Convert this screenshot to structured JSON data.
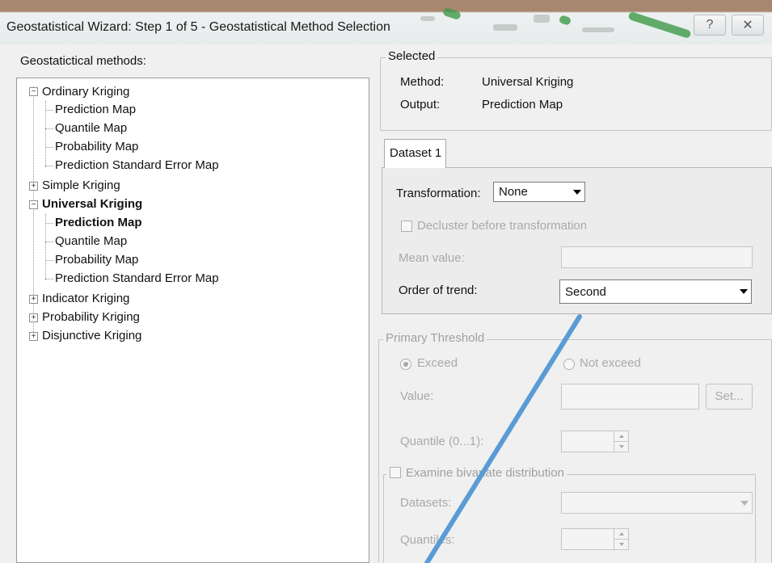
{
  "window": {
    "title": "Geostatistical Wizard: Step 1 of 5 - Geostatistical Method Selection",
    "help_icon": "help-icon",
    "close_icon": "close-icon",
    "help_glyph": "?",
    "close_glyph": "✕"
  },
  "tree": {
    "label": "Geostatictical methods:",
    "collapse_glyph": "−",
    "expand_glyph": "+",
    "nodes": [
      {
        "label": "Ordinary Kriging",
        "level": 0,
        "expander": "minus",
        "bold": false
      },
      {
        "label": "Prediction Map",
        "level": 1,
        "bold": false
      },
      {
        "label": "Quantile Map",
        "level": 1,
        "bold": false
      },
      {
        "label": "Probability Map",
        "level": 1,
        "bold": false
      },
      {
        "label": "Prediction Standard Error Map",
        "level": 1,
        "bold": false
      },
      {
        "label": "Simple Kriging",
        "level": 0,
        "expander": "plus",
        "bold": false
      },
      {
        "label": "Universal Kriging",
        "level": 0,
        "expander": "minus",
        "bold": true
      },
      {
        "label": "Prediction Map",
        "level": 1,
        "bold": true
      },
      {
        "label": "Quantile Map",
        "level": 1,
        "bold": false
      },
      {
        "label": "Probability Map",
        "level": 1,
        "bold": false
      },
      {
        "label": "Prediction Standard Error Map",
        "level": 1,
        "bold": false
      },
      {
        "label": "Indicator Kriging",
        "level": 0,
        "expander": "plus",
        "bold": false
      },
      {
        "label": "Probability Kriging",
        "level": 0,
        "expander": "plus",
        "bold": false
      },
      {
        "label": "Disjunctive Kriging",
        "level": 0,
        "expander": "plus",
        "bold": false
      }
    ]
  },
  "selected": {
    "title": "Selected",
    "method_label": "Method:",
    "method_value": "Universal Kriging",
    "output_label": "Output:",
    "output_value": "Prediction Map"
  },
  "dataset": {
    "tab_label": "Dataset 1",
    "transformation_label": "Transformation:",
    "transformation_value": "None",
    "decluster_label": "Decluster before transformation",
    "mean_label": "Mean value:",
    "order_label": "Order of trend:",
    "order_value": "Second"
  },
  "threshold": {
    "title": "Primary Threshold",
    "exceed_label": "Exceed",
    "not_exceed_label": "Not exceed",
    "value_label": "Value:",
    "set_button": "Set...",
    "quantile_label": "Quantile (0...1):",
    "bivariate_label": "Examine bivariate distribution",
    "datasets_label": "Datasets:",
    "quantiles_label": "Quantiles:"
  },
  "colors": {
    "annotation_line": "#5b9bd5",
    "title_band": "#a88770"
  }
}
